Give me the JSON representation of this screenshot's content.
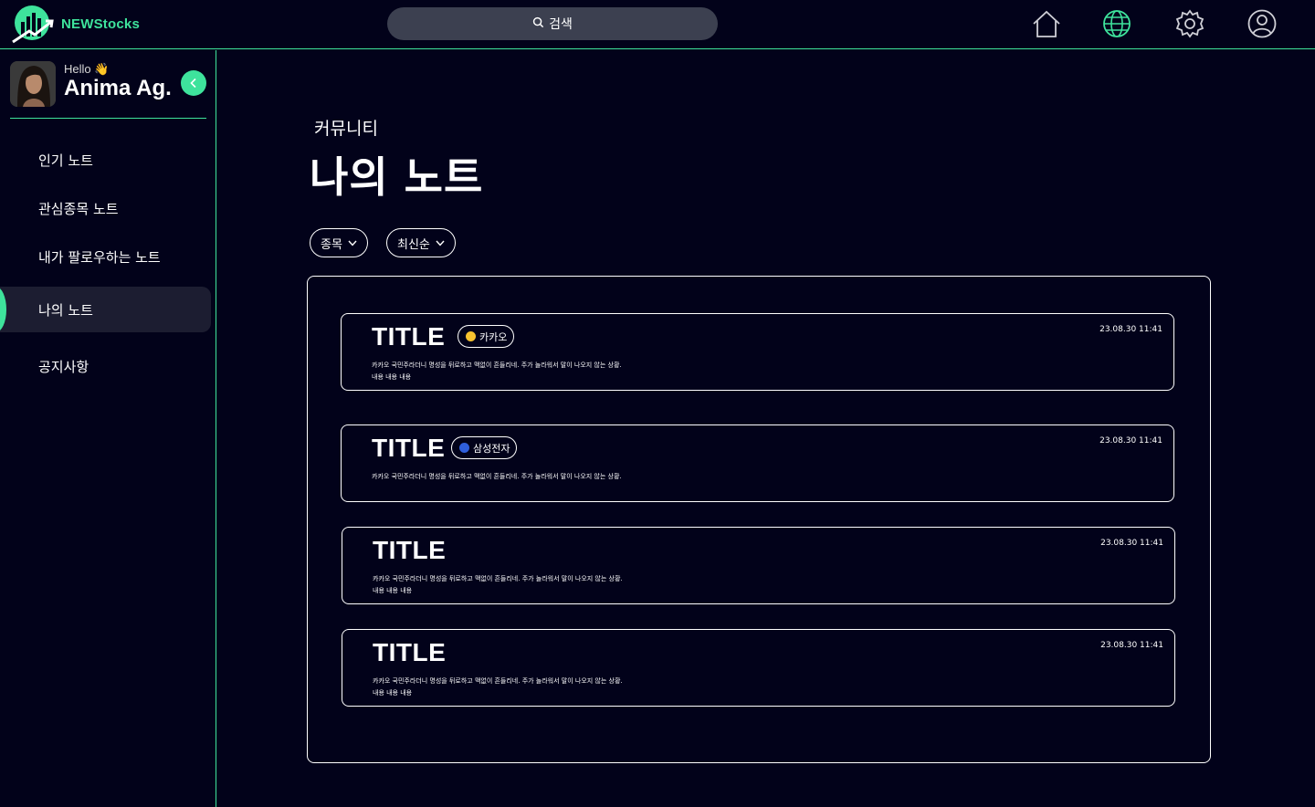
{
  "app": {
    "brand": "NEWStocks"
  },
  "colors": {
    "accent": "#3ee39c",
    "background": "#02021a",
    "active_bg": "#1c1d31",
    "search_bg": "#3c4050"
  },
  "search": {
    "label": "검색",
    "icon": "search-icon"
  },
  "nav_icons": [
    "home-icon",
    "globe-icon",
    "gear-icon",
    "user-icon"
  ],
  "profile": {
    "greeting": "Hello",
    "wave": "👋",
    "name": "Anima Ag."
  },
  "sidebar": {
    "items": [
      {
        "label": "인기 노트",
        "active": false
      },
      {
        "label": "관심종목 노트",
        "active": false
      },
      {
        "label": "내가 팔로우하는 노트",
        "active": false
      },
      {
        "label": "나의 노트",
        "active": true
      },
      {
        "label": "공지사항",
        "active": false
      }
    ]
  },
  "page": {
    "breadcrumb": "커뮤니티",
    "title": "나의 노트"
  },
  "filters": [
    {
      "label": "종목"
    },
    {
      "label": "최신순"
    }
  ],
  "notes": [
    {
      "title": "TITLE",
      "tag": "카카오",
      "tag_color": "#f7c22f",
      "date": "23.08.30 11:41",
      "line1": "카카오 국민주라더니 명성을 뒤로하고 맥없이 흔들리네. 주가 놀라워서 말이 나오지 않는 상황.",
      "line2": "내용 내용 내용"
    },
    {
      "title": "TITLE",
      "tag": "삼성전자",
      "tag_color": "#2f5fdc",
      "date": "23.08.30 11:41",
      "line1": "카카오 국민주라더니 명성을 뒤로하고 맥없이 흔들리네. 주가 놀라워서 말이 나오지 않는 상황.",
      "line2": ""
    },
    {
      "title": "TITLE",
      "tag": "",
      "date": "23.08.30 11:41",
      "line1": "카카오 국민주라더니 명성을 뒤로하고 맥없이 흔들리네. 주가 놀라워서 말이 나오지 않는 상황.",
      "line2": "내용 내용 내용"
    },
    {
      "title": "TITLE",
      "tag": "",
      "date": "23.08.30 11:41",
      "line1": "카카오 국민주라더니 명성을 뒤로하고 맥없이 흔들리네. 주가 놀라워서 말이 나오지 않는 상황.",
      "line2": "내용 내용 내용"
    }
  ]
}
